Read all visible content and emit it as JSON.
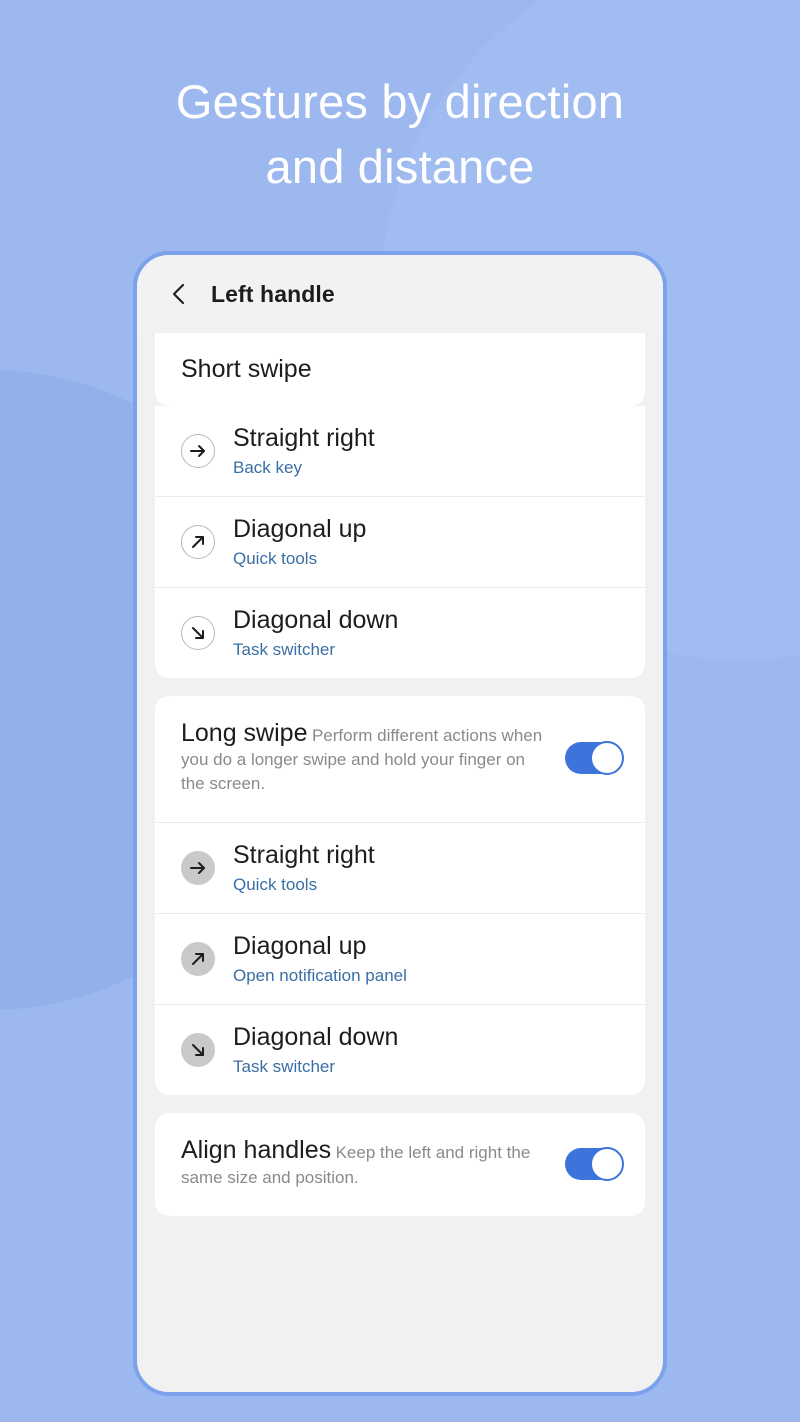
{
  "promo": {
    "title": "Gestures by direction\nand distance",
    "background_color": "#9cb8ef",
    "title_color": "#ffffff"
  },
  "colors": {
    "accent": "#3d74dc",
    "link": "#3a6ea5",
    "screen_bg": "#f1f1f1",
    "card_bg": "#ffffff",
    "subtitle_gray": "#8a8a8a"
  },
  "appbar": {
    "back_icon": "chevron-left-icon",
    "title": "Left handle"
  },
  "sections": [
    {
      "id": "short-swipe",
      "header": "Short swipe",
      "icon_style": "outline",
      "items": [
        {
          "icon": "arrow-right-icon",
          "title": "Straight right",
          "subtitle": "Back key"
        },
        {
          "icon": "arrow-up-right-icon",
          "title": "Diagonal up",
          "subtitle": "Quick tools"
        },
        {
          "icon": "arrow-down-right-icon",
          "title": "Diagonal down",
          "subtitle": "Task switcher"
        }
      ]
    },
    {
      "id": "long-swipe",
      "toggle": {
        "title": "Long swipe",
        "subtitle": "Perform different actions when you do a longer swipe and hold your finger on the screen.",
        "state": "on"
      },
      "icon_style": "filled",
      "items": [
        {
          "icon": "arrow-right-icon",
          "title": "Straight right",
          "subtitle": "Quick tools"
        },
        {
          "icon": "arrow-up-right-icon",
          "title": "Diagonal up",
          "subtitle": "Open notification panel"
        },
        {
          "icon": "arrow-down-right-icon",
          "title": "Diagonal down",
          "subtitle": "Task switcher"
        }
      ]
    },
    {
      "id": "align-handles",
      "toggle": {
        "title": "Align handles",
        "subtitle": "Keep the left and right the same size and position.",
        "state": "on"
      },
      "items": []
    }
  ]
}
